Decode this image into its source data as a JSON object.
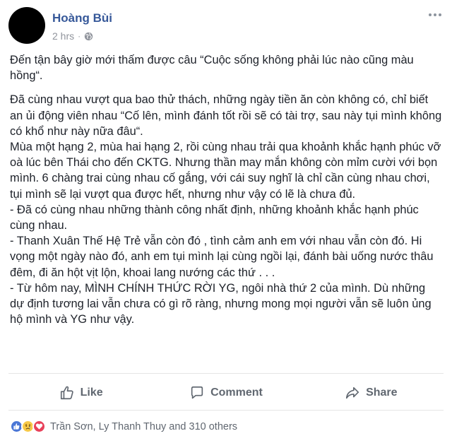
{
  "post": {
    "author": "Hoàng Bùi",
    "time": "2 hrs",
    "separator": "·",
    "privacy_icon": "globe-icon",
    "paragraphs": [
      "Đến tận bây giờ mới thấm được câu “Cuộc sống không phải lúc nào cũng màu hồng“.",
      "Đã cùng nhau vượt qua bao thử thách, những ngày tiền ăn còn không có, chỉ biết an ủi động viên nhau “Cố lên, mình đánh tốt rồi sẽ có tài trợ, sau này tụi mình không có khổ như này nữa đâu“.",
      "Mùa một hạng 2, mùa hai hạng 2, rồi cùng nhau trải qua khoảnh khắc hạnh phúc vỡ oà lúc bên Thái cho đến CKTG. Nhưng thần may mắn không còn mỉm cười với bọn mình. 6 chàng trai cùng nhau cố gắng, với cái suy nghĩ là chỉ cần cùng nhau chơi, tụi mình sẽ lại vượt qua được hết, nhưng như vậy có lẽ là chưa đủ.",
      "- Đã có cùng nhau những thành công nhất định, những khoảnh khắc hạnh phúc cùng nhau.",
      "- Thanh Xuân Thế Hệ Trẻ vẫn còn đó , tình cảm anh em với nhau vẫn còn đó. Hi vọng một ngày nào đó, anh em tụi mình lại cùng ngồi lại, đánh bài uống nước thâu đêm, đi ăn hột vịt lộn, khoai lang nướng các thứ . . .",
      "- Từ hôm nay, MÌNH CHÍNH THỨC RỜI YG, ngôi nhà thứ 2 của mình. Dù những dự định tương lai vẫn chưa có gì rõ ràng, nhưng mong mọi người vẫn sẽ luôn ủng hộ mình và YG như vậy."
    ]
  },
  "actions": {
    "like": "Like",
    "comment": "Comment",
    "share": "Share"
  },
  "reactions": {
    "icons": [
      "like-icon",
      "sad-icon",
      "love-icon"
    ],
    "summary": "Trần Sơn, Ly Thanh Thuy and 310 others"
  },
  "colors": {
    "author": "#365899",
    "meta": "#90949c",
    "action": "#606770",
    "like": "#4a76d6",
    "love": "#e8415a",
    "sad": "#f7c948"
  }
}
